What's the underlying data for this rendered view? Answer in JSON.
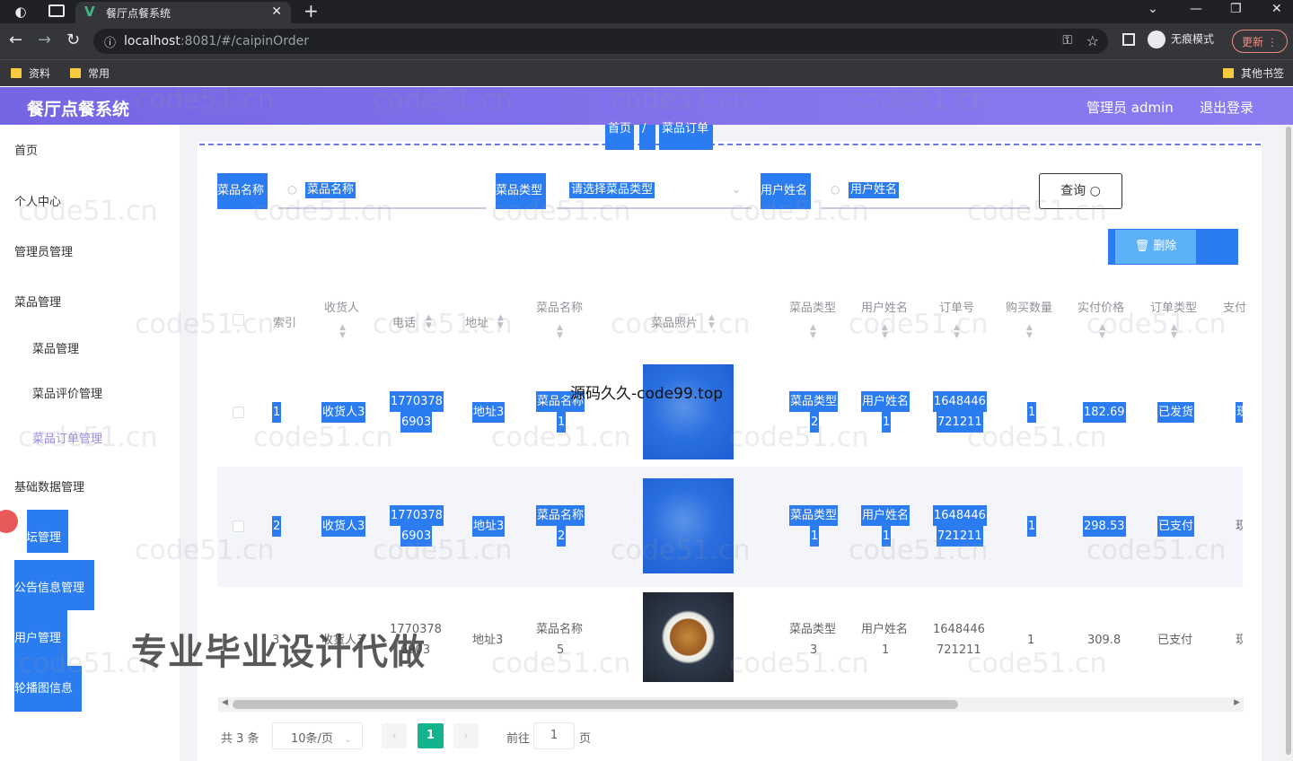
{
  "browser": {
    "tab_title": "餐厅点餐系统",
    "tab_close": "✕",
    "new_tab": "+",
    "url_host": "localhost",
    "url_rest": ":8081/#/caipinOrder",
    "incognito_label": "无痕模式",
    "update_label": "更新",
    "bookmarks": [
      "资料",
      "常用"
    ],
    "other_bookmarks": "其他书签"
  },
  "header": {
    "title": "餐厅点餐系统",
    "user": "管理员 admin",
    "logout": "退出登录"
  },
  "sidebar": {
    "items": [
      {
        "label": "首页"
      },
      {
        "label": "个人中心"
      },
      {
        "label": "管理员管理"
      },
      {
        "label": "菜品管理"
      },
      {
        "label": "菜品管理"
      },
      {
        "label": "菜品评价管理"
      },
      {
        "label": "菜品订单管理"
      },
      {
        "label": "基础数据管理"
      },
      {
        "label": "论坛管理"
      },
      {
        "label": "公告信息管理"
      },
      {
        "label": "用户管理"
      },
      {
        "label": "轮播图信息"
      }
    ]
  },
  "breadcrumb": {
    "home": "首页",
    "sep": "/",
    "current": "菜品订单"
  },
  "search": {
    "dish_name_label": "菜品名称",
    "dish_name_placeholder": "菜品名称",
    "dish_type_label": "菜品类型",
    "dish_type_placeholder": "请选择菜品类型",
    "user_name_label": "用户姓名",
    "user_name_placeholder": "用户姓名",
    "query_button": "查询"
  },
  "actions": {
    "delete_button": "删除"
  },
  "table": {
    "headers": {
      "index": "索引",
      "receiver": "收货人",
      "phone": "电话",
      "address": "地址",
      "dish_name": "菜品名称",
      "dish_photo": "菜品照片",
      "dish_type": "菜品类型",
      "user_name": "用户姓名",
      "order_no": "订单号",
      "quantity": "购买数量",
      "paid_price": "实付价格",
      "order_type": "订单类型",
      "pay": "支付"
    },
    "rows": [
      {
        "index": "1",
        "receiver": "收货人3",
        "phone_a": "1770378",
        "phone_b": "6903",
        "address": "地址3",
        "dish_a": "菜品名称",
        "dish_b": "1",
        "type_a": "菜品类型",
        "type_b": "2",
        "user_a": "用户姓名",
        "user_b": "1",
        "order_a": "1648446",
        "order_b": "721211",
        "qty": "1",
        "price": "182.69",
        "status": "已发货",
        "pay": "现"
      },
      {
        "index": "2",
        "receiver": "收货人3",
        "phone_a": "1770378",
        "phone_b": "6903",
        "address": "地址3",
        "dish_a": "菜品名称",
        "dish_b": "2",
        "type_a": "菜品类型",
        "type_b": "1",
        "user_a": "用户姓名",
        "user_b": "1",
        "order_a": "1648446",
        "order_b": "721211",
        "qty": "1",
        "price": "298.53",
        "status": "已支付",
        "pay": "现"
      },
      {
        "index": "3",
        "receiver": "收货人3",
        "phone_a": "1770378",
        "phone_b": "6903",
        "address": "地址3",
        "dish_a": "菜品名称",
        "dish_b": "5",
        "type_a": "菜品类型",
        "type_b": "3",
        "user_a": "用户姓名",
        "user_b": "1",
        "order_a": "1648446",
        "order_b": "721211",
        "qty": "1",
        "price": "309.8",
        "status": "已支付",
        "pay": "现"
      }
    ]
  },
  "pagination": {
    "total": "共 3 条",
    "page_size": "10条/页",
    "current": "1",
    "goto_label": "前往",
    "goto_value": "1",
    "page_suffix": "页"
  },
  "overlays": {
    "source_text": "源码久久-code99.top",
    "promo_text": "专业毕业设计代做",
    "watermark": "code51.cn"
  }
}
